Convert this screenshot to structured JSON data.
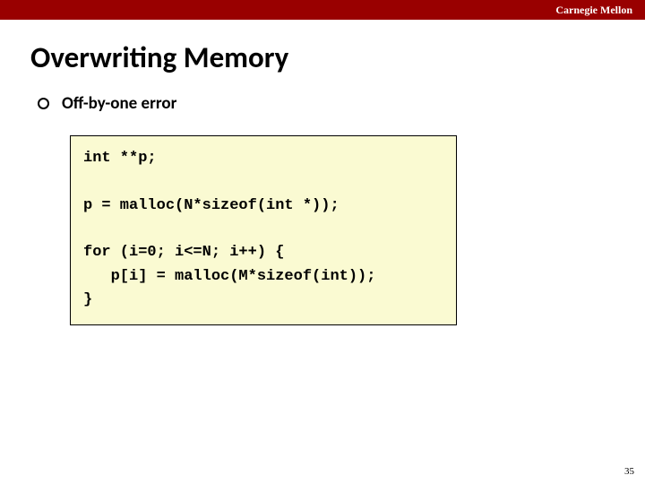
{
  "header": {
    "institution": "Carnegie Mellon"
  },
  "slide": {
    "title": "Overwriting Memory",
    "bullets": [
      {
        "text": "Off-by-one error"
      }
    ],
    "code_lines": [
      "int **p;",
      "",
      "p = malloc(N*sizeof(int *));",
      "",
      "for (i=0; i<=N; i++) {",
      "   p[i] = malloc(M*sizeof(int));",
      "}"
    ],
    "page_number": "35"
  }
}
